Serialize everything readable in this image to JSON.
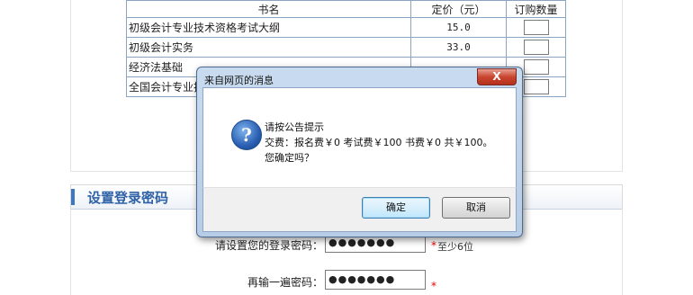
{
  "book_table": {
    "headers": [
      "书名",
      "定价（元）",
      "订购数量"
    ],
    "rows": [
      {
        "name": "初级会计专业技术资格考试大纲",
        "price": "15.0"
      },
      {
        "name": "初级会计实务",
        "price": "33.0"
      },
      {
        "name": "经济法基础",
        "price": ""
      },
      {
        "name": "全国会计专业技",
        "price": ""
      }
    ]
  },
  "section": {
    "title": "设置登录密码"
  },
  "form": {
    "password_label": "请设置您的登录密码：",
    "password_value": "●●●●●●●",
    "password_hint": "至少6位",
    "confirm_label": "再输一遍密码：",
    "confirm_value": "●●●●●●●",
    "required_mark": "*"
  },
  "dialog": {
    "title": "来自网页的消息",
    "close_label": "X",
    "icon": "question-icon",
    "line1": "请按公告提示",
    "line2": "交费：报名费￥0 考试费￥100 书费￥0 共￥100。",
    "line3": "您确定吗？",
    "ok_label": "确定",
    "cancel_label": "取消"
  }
}
